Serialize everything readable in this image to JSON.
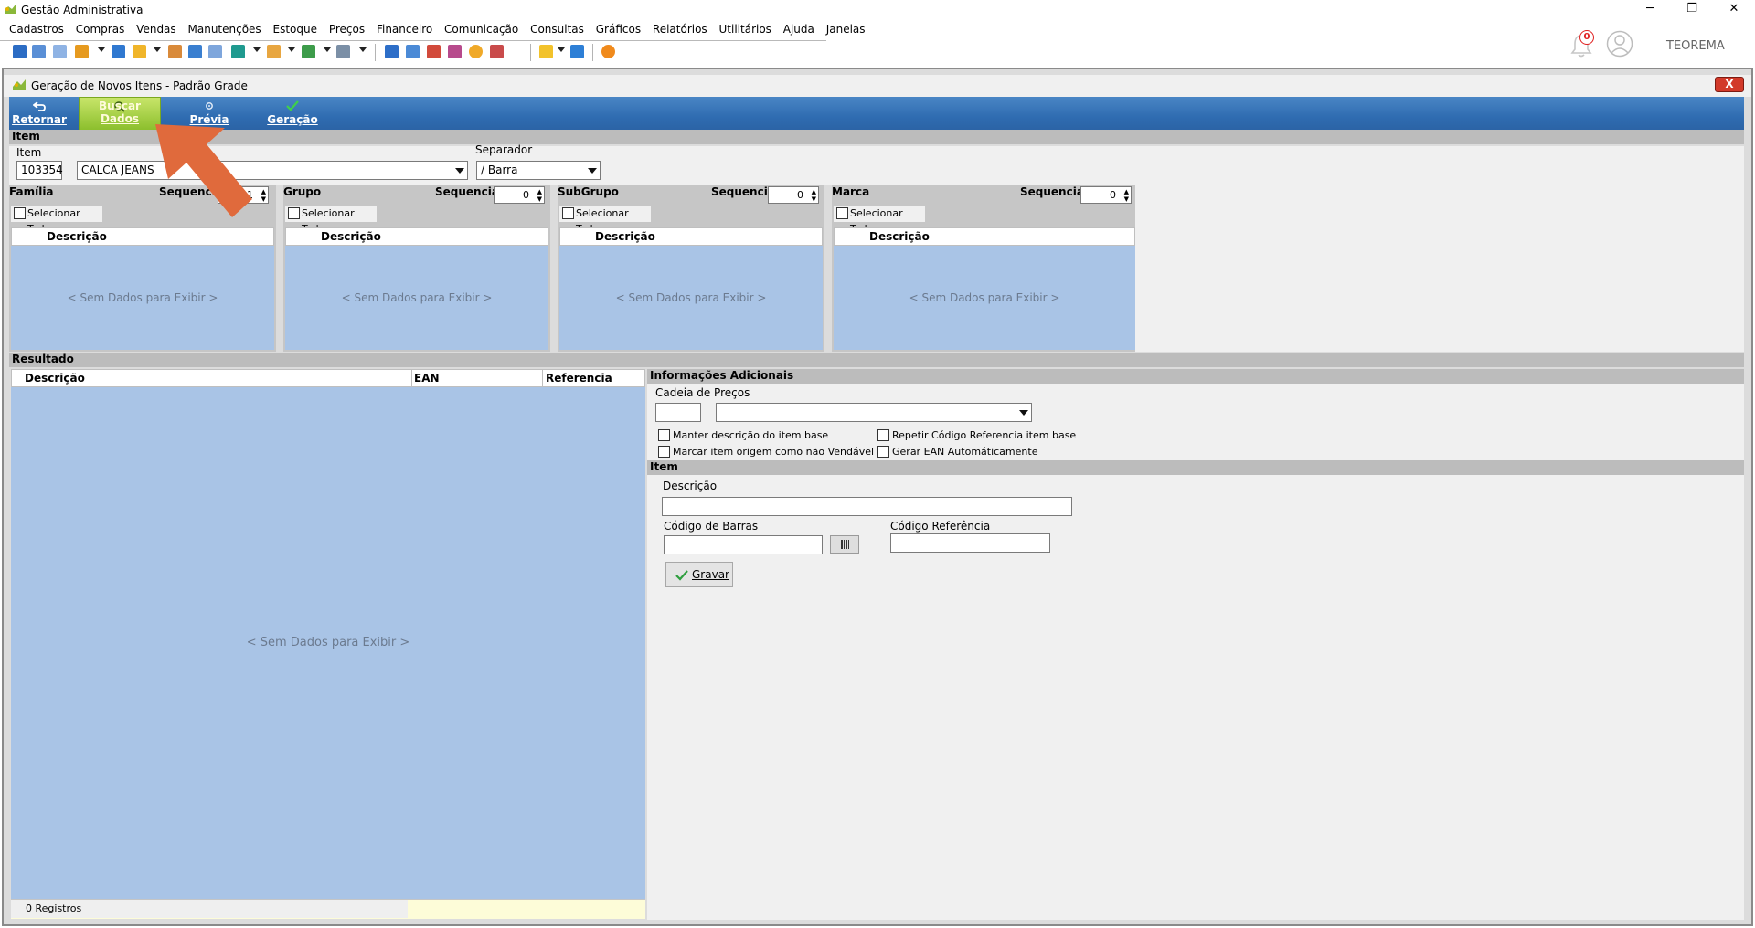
{
  "app": {
    "title": "Gestão Administrativa",
    "user": "TEOREMA",
    "notification_count": "0"
  },
  "menu": [
    "Cadastros",
    "Compras",
    "Vendas",
    "Manutenções",
    "Estoque",
    "Preços",
    "Financeiro",
    "Comunicação",
    "Consultas",
    "Gráficos",
    "Relatórios",
    "Utilitários",
    "Ajuda",
    "Janelas"
  ],
  "window": {
    "title": "Geração de Novos Itens - Padrão Grade",
    "close_label": "X"
  },
  "ribbon": {
    "retornar": "Retornar",
    "buscar": "Buscar Dados",
    "previa": "Prévia",
    "geracao": "Geração"
  },
  "item": {
    "section": "Item",
    "label": "Item",
    "code": "103354",
    "description": "CALCA JEANS",
    "separator_label": "Separador",
    "separator_value": "/ Barra"
  },
  "groups": [
    {
      "title": "Família",
      "seq_label": "Sequencia",
      "seq": "1",
      "select_all": "Selecionar Todos",
      "col": "Descrição",
      "empty": "< Sem Dados para Exibir >"
    },
    {
      "title": "Grupo",
      "seq_label": "Sequencia",
      "seq": "0",
      "select_all": "Selecionar Todos",
      "col": "Descrição",
      "empty": "< Sem Dados para Exibir >"
    },
    {
      "title": "SubGrupo",
      "seq_label": "Sequencia",
      "seq": "0",
      "select_all": "Selecionar Todos",
      "col": "Descrição",
      "empty": "< Sem Dados para Exibir >"
    },
    {
      "title": "Marca",
      "seq_label": "Sequencia",
      "seq": "0",
      "select_all": "Selecionar Todos",
      "col": "Descrição",
      "empty": "< Sem Dados para Exibir >"
    }
  ],
  "resultado": {
    "section": "Resultado",
    "columns": [
      "Descrição",
      "EAN",
      "Referencia"
    ],
    "empty": "< Sem Dados para Exibir >",
    "footer": "0 Registros"
  },
  "info": {
    "section": "Informações Adicionais",
    "cadeia_label": "Cadeia de Preços",
    "manter": "Manter descrição do item base",
    "marcar": "Marcar item origem como não Vendável",
    "repetir": "Repetir Código Referencia item base",
    "gerar_ean": "Gerar EAN Automáticamente",
    "item_section": "Item",
    "descricao_label": "Descrição",
    "barras_label": "Código de Barras",
    "referencia_label": "Código Referência",
    "gravar": "Gravar"
  }
}
